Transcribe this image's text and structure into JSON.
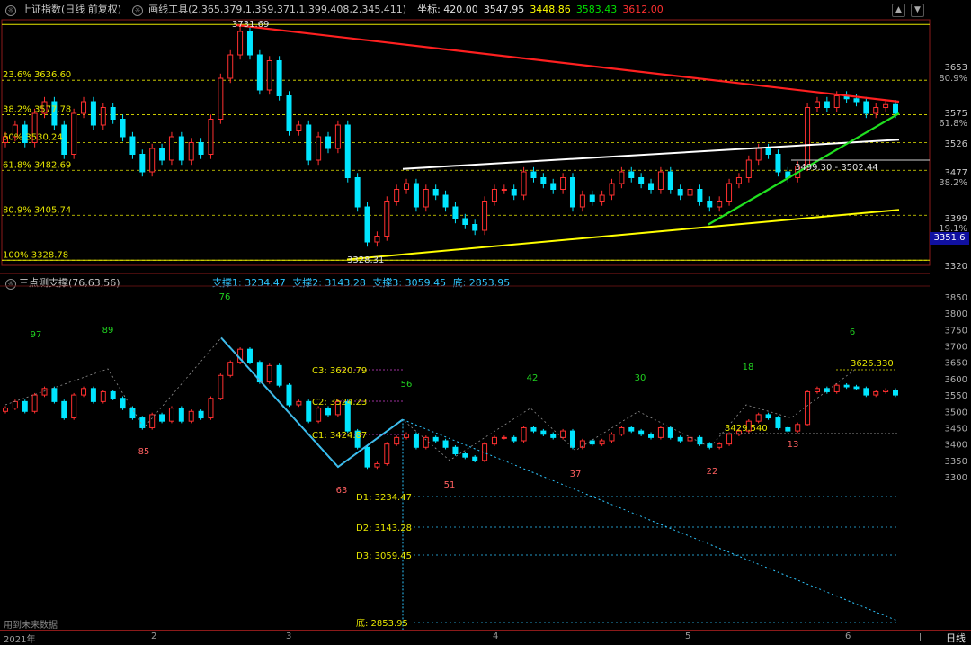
{
  "header": {
    "title": "上证指数(日线 前复权)",
    "tool": "画线工具(2,365,379,1,359,371,1,399,408,2,345,411)",
    "coord_label": "坐标: 420.00",
    "values": [
      "3547.95",
      "3448.86",
      "3583.43",
      "3612.00"
    ]
  },
  "sub_header": {
    "title": "三点测支撑(76,63,56)",
    "support1": "支撑1: 3234.47",
    "support2": "支撑2: 3143.28",
    "support3": "支撑3: 3059.45",
    "bottom": "底: 2853.95"
  },
  "current_price": "3351.6",
  "future_note": "用到未来数据",
  "period_button": "日线",
  "colors": {
    "up": "#ff3030",
    "down": "#00e5ff",
    "fib": "#e6e600",
    "bg": "#000000"
  },
  "chart_data": [
    {
      "type": "candlestick",
      "title": "上证指数(日线 前复权)",
      "x_ticks": [
        "2021年",
        "2",
        "3",
        "4",
        "5",
        "6"
      ],
      "y_ticks": [
        "3653",
        "80.9%",
        "3575",
        "61.8%",
        "3526",
        "3477",
        "38.2%",
        "3399",
        "19.1%",
        "3320"
      ],
      "ylim": [
        3320,
        3740
      ],
      "fib_levels": [
        {
          "label": "23.6% 3636.60",
          "value": 3636.6
        },
        {
          "label": "38.2% 3577.78",
          "value": 3577.78
        },
        {
          "label": "50% 3530.24",
          "value": 3530.24
        },
        {
          "label": "61.8% 3482.69",
          "value": 3482.69
        },
        {
          "label": "80.9% 3405.74",
          "value": 3405.74
        },
        {
          "label": "100% 3328.78",
          "value": 3328.78
        }
      ],
      "annotations": [
        "3731.69",
        "3328.31",
        "3499.30 - 3502.44"
      ],
      "close": [
        3540,
        3560,
        3530,
        3580,
        3600,
        3560,
        3510,
        3580,
        3600,
        3560,
        3590,
        3570,
        3540,
        3510,
        3480,
        3520,
        3500,
        3540,
        3500,
        3530,
        3510,
        3570,
        3640,
        3680,
        3720,
        3680,
        3620,
        3670,
        3610,
        3550,
        3560,
        3500,
        3540,
        3520,
        3560,
        3470,
        3420,
        3360,
        3370,
        3430,
        3450,
        3460,
        3420,
        3450,
        3440,
        3420,
        3400,
        3390,
        3380,
        3430,
        3450,
        3450,
        3440,
        3480,
        3470,
        3460,
        3450,
        3470,
        3420,
        3440,
        3430,
        3440,
        3460,
        3480,
        3470,
        3460,
        3450,
        3480,
        3450,
        3440,
        3450,
        3430,
        3420,
        3430,
        3460,
        3470,
        3500,
        3520,
        3510,
        3480,
        3470,
        3490,
        3590,
        3600,
        3590,
        3610,
        3605,
        3600,
        3580,
        3590,
        3595,
        3580
      ]
    },
    {
      "type": "candlestick",
      "title": "三点测支撑(76,63,56)",
      "y_ticks": [
        "3850",
        "3800",
        "3750",
        "3700",
        "3650",
        "3600",
        "3550",
        "3500",
        "3450",
        "3400",
        "3350",
        "3300"
      ],
      "ylim": [
        3250,
        3880
      ],
      "support_levels": [
        {
          "label": "C3: 3620.79",
          "value": 3620.79
        },
        {
          "label": "C2: 3524.23",
          "value": 3524.23
        },
        {
          "label": "C1: 3424.87",
          "value": 3424.87
        },
        {
          "label": "D1: 3234.47",
          "value": 3234.47
        },
        {
          "label": "D2: 3143.28",
          "value": 3143.28
        },
        {
          "label": "D3: 3059.45",
          "value": 3059.45
        },
        {
          "label": "底: 2853.95",
          "value": 2853.95
        }
      ],
      "annotations": [
        "3429.540",
        "3626.330"
      ],
      "counts": [
        "97",
        "89",
        "85",
        "76",
        "63",
        "56",
        "51",
        "42",
        "37",
        "30",
        "22",
        "18",
        "13",
        "6"
      ]
    }
  ]
}
